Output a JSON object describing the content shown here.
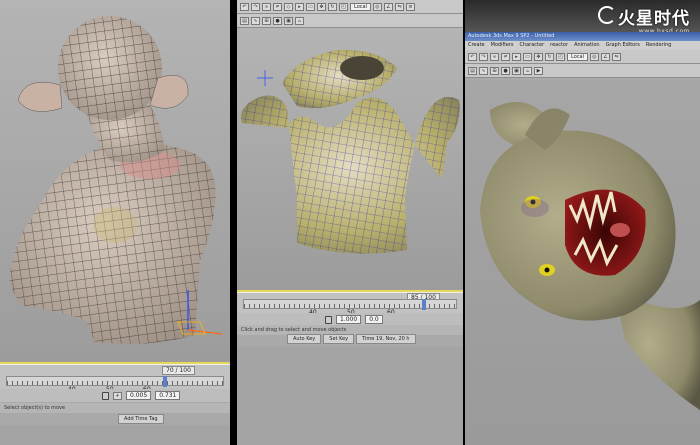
{
  "logo": {
    "brand": "火星时代",
    "url": "www.hxsd.com"
  },
  "panel1": {
    "slider": {
      "labels": [
        "40",
        "50",
        "60"
      ],
      "counter": "70 / 100",
      "position": 0.72
    },
    "fields": {
      "value_a": "0.005",
      "value_b": "0.731"
    },
    "status": "Select object(s) to move",
    "tabs": [
      "Add Time Tag"
    ],
    "colors": {
      "mesh_skin": "#c9b9ab",
      "wire": "#2a2a2a",
      "highlight": "#d98c8c"
    }
  },
  "panel2": {
    "slider": {
      "labels": [
        "40",
        "50",
        "60"
      ],
      "counter": "85 / 100",
      "position": 0.84
    },
    "fields": {
      "value_a": "1.000",
      "value_b": "0.0"
    },
    "status": "Click and drag to select and move objects",
    "tabs": [
      "Auto Key",
      "Set Key"
    ],
    "time_tag": "Time 19, Nov, 20 h",
    "toolbar_dropdown": "Local",
    "colors": {
      "mesh_skin": "#b8af6a",
      "wire": "#2a2ab0"
    }
  },
  "panel3": {
    "title": "Autodesk 3ds Max 9 SP2 - Untitled",
    "menus": [
      "Create",
      "Modifiers",
      "Character",
      "reactor",
      "Animation",
      "Graph Editors",
      "Rendering"
    ],
    "toolbar_dropdown": "Local",
    "colors": {
      "skin": "#8e8a6a",
      "mouth": "#7a1010",
      "eye": "#e0d020"
    }
  }
}
